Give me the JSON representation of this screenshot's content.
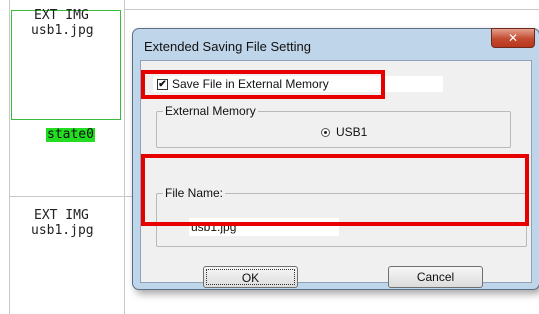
{
  "panel": {
    "top_line1": "EXT IMG",
    "top_line2": "usb1.jpg",
    "state_label": "state0",
    "bottom_line1": "EXT IMG",
    "bottom_line2": "usb1.jpg"
  },
  "dialog": {
    "title": "Extended Saving File Setting",
    "close_glyph": "✕",
    "save_checkbox": {
      "label": "Save File in External Memory",
      "checked": true,
      "mark": "✔"
    },
    "external_memory": {
      "group_label": "External Memory",
      "option_label": "USB1",
      "selected": true
    },
    "file_name": {
      "group_label": "File Name:",
      "value": "usb1.jpg"
    },
    "ok_label": "OK",
    "cancel_label": "Cancel"
  },
  "colors": {
    "highlight": "#e60000",
    "state_bg": "#22dd22",
    "close_button": "#c24a2f",
    "dialog_frame": "#bfd5ea"
  }
}
